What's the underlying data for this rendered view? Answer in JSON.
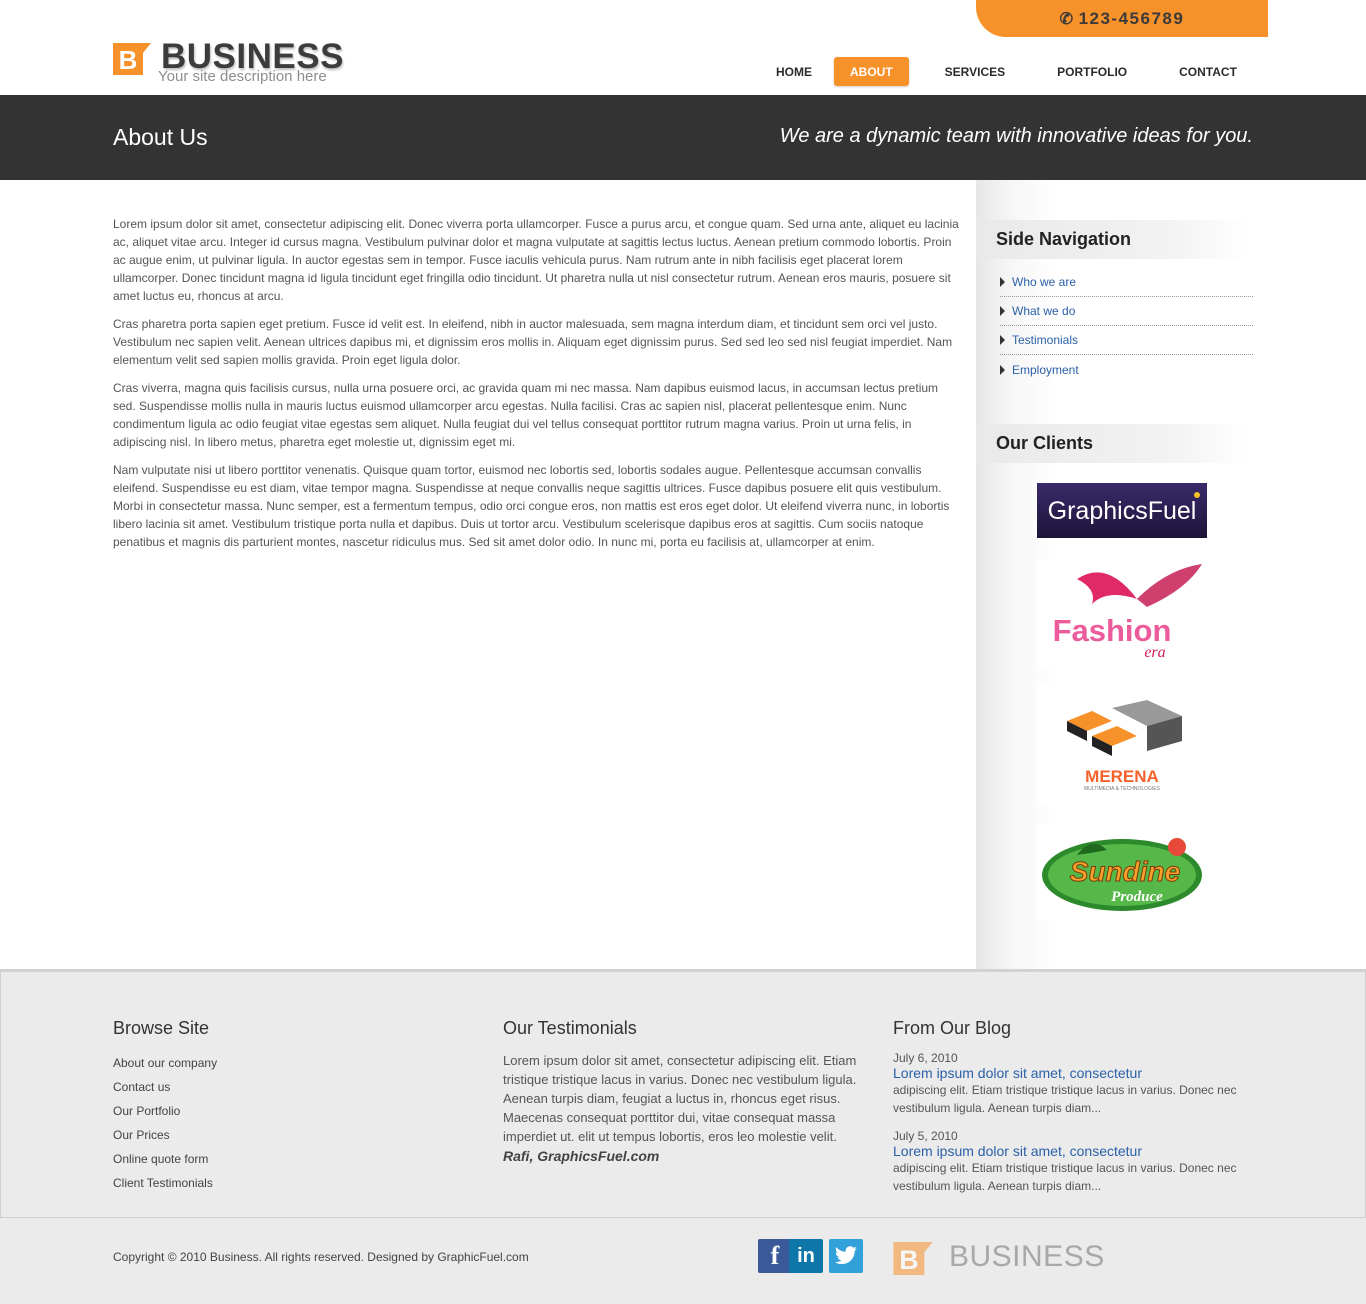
{
  "header": {
    "phone": "123-456789",
    "logo_name": "BUSINESS",
    "logo_description": "Your site description here",
    "nav": [
      {
        "label": "HOME"
      },
      {
        "label": "ABOUT",
        "active": true
      },
      {
        "label": "SERVICES"
      },
      {
        "label": "PORTFOLIO"
      },
      {
        "label": "CONTACT"
      }
    ],
    "accent_color": "#f7912a"
  },
  "titlebar": {
    "title": "About Us",
    "tagline": "We are a dynamic team with innovative ideas for you."
  },
  "content": {
    "paragraphs": [
      "Lorem ipsum dolor sit amet, consectetur adipiscing elit. Donec viverra porta ullamcorper. Fusce a purus arcu, et congue quam. Sed urna ante, aliquet eu lacinia ac, aliquet vitae arcu. Integer id cursus magna. Vestibulum pulvinar dolor et magna vulputate at sagittis lectus luctus. Aenean pretium commodo lobortis. Proin ac augue enim, ut pulvinar ligula. In auctor egestas sem in tempor. Fusce iaculis vehicula purus. Nam rutrum ante in nibh facilisis eget placerat lorem ullamcorper. Donec tincidunt magna id ligula tincidunt eget fringilla odio tincidunt. Ut pharetra nulla ut nisl consectetur rutrum. Aenean eros mauris, posuere sit amet luctus eu, rhoncus at arcu.",
      "Cras pharetra porta sapien eget pretium. Fusce id velit est. In eleifend, nibh in auctor malesuada, sem magna interdum diam, et tincidunt sem orci vel justo. Vestibulum nec sapien velit. Aenean ultrices dapibus mi, et dignissim eros mollis in. Aliquam eget dignissim purus. Sed sed leo sed nisl feugiat imperdiet. Nam elementum velit sed sapien mollis gravida. Proin eget ligula dolor.",
      "Cras viverra, magna quis facilisis cursus, nulla urna posuere orci, ac gravida quam mi nec massa. Nam dapibus euismod lacus, in accumsan lectus pretium sed. Suspendisse mollis nulla in mauris luctus euismod ullamcorper arcu egestas. Nulla facilisi. Cras ac sapien nisl, placerat pellentesque enim. Nunc condimentum ligula ac odio feugiat vitae egestas sem aliquet. Nulla feugiat dui vel tellus consequat porttitor rutrum magna varius. Proin ut urna felis, in adipiscing nisl. In libero metus, pharetra eget molestie ut, dignissim eget mi.",
      "Nam vulputate nisi ut libero porttitor venenatis. Quisque quam tortor, euismod nec lobortis sed, lobortis sodales augue. Pellentesque accumsan convallis eleifend. Suspendisse eu est diam, vitae tempor magna. Suspendisse at neque convallis neque sagittis ultrices. Fusce dapibus posuere elit quis vestibulum. Morbi in consectetur massa. Nunc semper, est a fermentum tempus, odio orci congue eros, non mattis est eros eget dolor. Ut eleifend viverra nunc, in lobortis libero lacinia sit amet. Vestibulum tristique porta nulla et dapibus. Duis ut tortor arcu. Vestibulum scelerisque dapibus eros at sagittis. Cum sociis natoque penatibus et magnis dis parturient montes, nascetur ridiculus mus. Sed sit amet dolor odio. In nunc mi, porta eu facilisis at, ullamcorper at enim."
    ]
  },
  "sidebar": {
    "nav_heading": "Side Navigation",
    "nav_items": [
      "Who we are",
      "What we do",
      "Testimonials",
      "Employment"
    ],
    "clients_heading": "Our Clients",
    "clients": [
      {
        "logo": "graphicsfuel-logo",
        "text": "GraphicsFuel"
      },
      {
        "logo": "fashion-era-logo",
        "text": "Fashion",
        "sub": "era"
      },
      {
        "logo": "merena-logo",
        "text": "MERENA",
        "sub": "MULTIMEDIA & TECHNOLOGIES"
      },
      {
        "logo": "sundine-logo",
        "text": "Sundine",
        "sub": "Produce"
      }
    ]
  },
  "footer": {
    "browse_heading": "Browse Site",
    "browse_links": [
      "About our company",
      "Contact us",
      "Our Portfolio",
      "Our Prices",
      "Online quote form",
      "Client Testimonials"
    ],
    "testimonials_heading": "Our Testimonials",
    "testimonial_text": "Lorem ipsum dolor sit amet, consectetur adipiscing elit. Etiam tristique tristique lacus in varius. Donec nec vestibulum ligula. Aenean turpis diam, feugiat a luctus in, rhoncus eget risus. Maecenas consequat porttitor dui, vitae consequat massa imperdiet ut. elit ut tempus lobortis, eros leo molestie velit.",
    "testimonial_author": "Rafi, GraphicsFuel.com",
    "blog_heading": "From Our Blog",
    "blog_posts": [
      {
        "date": "July 6, 2010",
        "title": "Lorem ipsum dolor sit amet, consectetur",
        "excerpt": "adipiscing elit. Etiam tristique tristique lacus in varius. Donec nec vestibulum ligula. Aenean turpis diam..."
      },
      {
        "date": "July 5, 2010",
        "title": "Lorem ipsum dolor sit amet, consectetur",
        "excerpt": "adipiscing elit. Etiam tristique tristique lacus in varius. Donec nec vestibulum ligula. Aenean turpis diam..."
      }
    ]
  },
  "bottom": {
    "copyright": "Copyright © 2010 Business. All rights reserved. Designed by GraphicFuel.com",
    "social": [
      {
        "icon": "facebook-icon",
        "glyph": "f",
        "color": "#3b5998"
      },
      {
        "icon": "linkedin-icon",
        "glyph": "in",
        "color": "#0e76a8"
      },
      {
        "icon": "twitter-icon",
        "glyph": "t",
        "color": "#33a1d9"
      }
    ],
    "logo_name": "BUSINESS"
  }
}
